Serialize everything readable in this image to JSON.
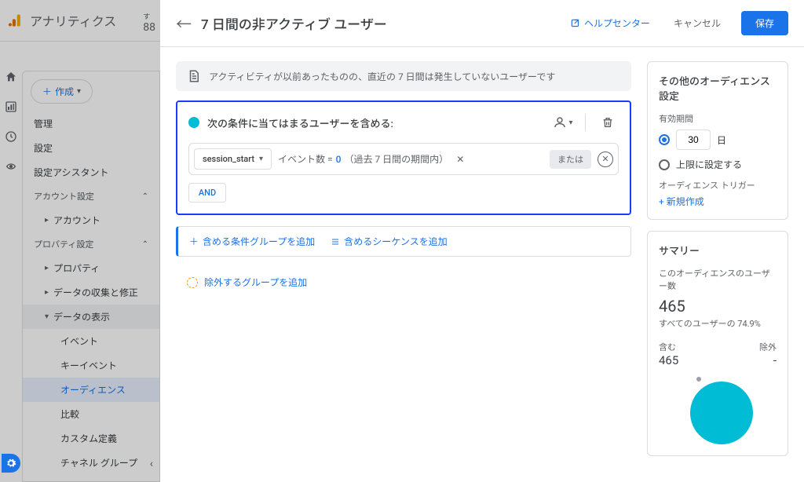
{
  "sidebar": {
    "brand": "アナリティクス",
    "topNumSmall": "す",
    "topNum": "88",
    "create": "作成",
    "items": [
      "管理",
      "設定",
      "設定アシスタント"
    ],
    "sec_account": "アカウント設定",
    "sub_account": "アカウント",
    "sec_property": "プロパティ設定",
    "sub_property": "プロパティ",
    "sub_data_collect": "データの収集と修正",
    "sub_data_view": "データの表示",
    "sub2": [
      "イベント",
      "キーイベント",
      "オーディエンス",
      "比較",
      "カスタム定義",
      "チャネル グループ"
    ]
  },
  "header": {
    "title": "7 日間の非アクティブ ユーザー",
    "help": "ヘルプセンター",
    "cancel": "キャンセル",
    "save": "保存"
  },
  "desc": "アクティビティが以前あったものの、直近の 7 日間は発生していないユーザーです",
  "cond": {
    "title": "次の条件に当てはまるユーザーを含める:",
    "event": "session_start",
    "param_label": "イベント数 =",
    "param_val": "0",
    "param_suffix": "（過去 7 日間の期間内）",
    "or": "または",
    "and": "AND"
  },
  "addGroup": "含める条件グループを追加",
  "addSequence": "含めるシーケンスを追加",
  "excludeGroup": "除外するグループを追加",
  "settings": {
    "title": "その他のオーディエンス設定",
    "duration_label": "有効期間",
    "days": "30",
    "days_unit": "日",
    "max_label": "上限に設定する",
    "trigger_label": "オーディエンス トリガー",
    "new": "+ 新規作成"
  },
  "summary": {
    "title": "サマリー",
    "users_label": "このオーディエンスのユーザー数",
    "users": "465",
    "pct": "すべてのユーザーの 74.9%",
    "include_label": "含む",
    "include_val": "465",
    "exclude_label": "除外",
    "exclude_val": "-"
  }
}
